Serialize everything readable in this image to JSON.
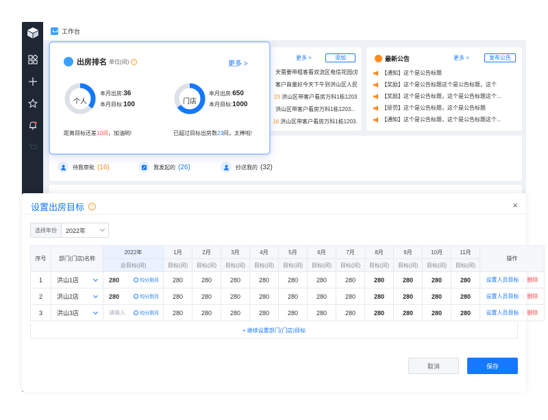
{
  "app": {
    "workbench_title": "工作台"
  },
  "task_list": {
    "more": "更多 >",
    "add": "添加",
    "rows": [
      "天需要带租客看双流区电信花园(双...",
      "客户商量好今天下午到洪山区人民...",
      "洪山区带客户看房万科1栋1203...",
      "洪山区带客户看房万科1栋1203...",
      "洪山区带客户看房万科1栋1203..."
    ],
    "row_prefixes": [
      "",
      "",
      "23",
      "",
      "16"
    ]
  },
  "announcements": {
    "title": "最新公告",
    "more": "更多 >",
    "publish": "发布公告",
    "rows": [
      "【通知】这个是公告标题",
      "【奖励】这个是公告标题这个是公告标题，这个",
      "【奖励】这个是公告标题，这个是公告标题这个...",
      "【惩罚】这个是公告标题，这个是公告标题",
      "【通知】这个是公告标题，这个是公告标题这个..."
    ]
  },
  "quick": [
    {
      "label": "待我审批",
      "count": "(16)"
    },
    {
      "label": "我发起的",
      "count": "(26)"
    },
    {
      "label": "抄送我的",
      "count": "(32)"
    }
  ],
  "ranking": {
    "title": "出房排名",
    "unit": "单位(间)",
    "more": "更多 >",
    "personal": {
      "label": "个人",
      "month_out_label": "本月出房:",
      "month_out": "36",
      "month_target_label": "本月目标:",
      "month_target": "100",
      "progress": 0.36,
      "note_before": "距离目标还差",
      "note_value": "10间",
      "note_after": "，加油哟!"
    },
    "store": {
      "label": "门店",
      "month_out_label": "本月出房:",
      "month_out": "650",
      "month_target_label": "本月目标:",
      "month_target": "1000",
      "progress": 0.65,
      "note_before": "已超过目标出房数",
      "note_value": "23",
      "note_after": "间，太棒啦!"
    }
  },
  "modal": {
    "title": "设置出房目标",
    "close": "×",
    "year_label": "选择年份",
    "year_value": "2022年",
    "columns": {
      "index": "序号",
      "dept": "部门(门店)名称",
      "year": "2022年",
      "year_sub": "总目标(间)",
      "months": [
        "1月",
        "2月",
        "3月",
        "4月",
        "5月",
        "6月",
        "7月",
        "8月",
        "9月",
        "10月",
        "11月"
      ],
      "month_sub": "目标(间)",
      "ops": "操作"
    },
    "rows": [
      {
        "index": "1",
        "name": "洪山1店",
        "total": "280",
        "avg": "均分到月",
        "months": [
          "280",
          "280",
          "280",
          "280",
          "280",
          "280",
          "280",
          "280",
          "280",
          "280",
          "280"
        ],
        "set": "设置人员目标",
        "del": "删除"
      },
      {
        "index": "2",
        "name": "洪山2店",
        "total": "280",
        "avg": "均分到月",
        "months": [
          "280",
          "280",
          "280",
          "280",
          "280",
          "280",
          "280",
          "280",
          "280",
          "280",
          "280"
        ],
        "set": "设置人员目标",
        "del": "删除"
      },
      {
        "index": "3",
        "name": "洪山3店",
        "total_placeholder": "请输入",
        "avg": "均分到月",
        "months": [
          "280",
          "280",
          "280",
          "280",
          "280",
          "280",
          "280",
          "280",
          "280",
          "280",
          "280"
        ],
        "set": "设置人员目标",
        "del": "删除"
      }
    ],
    "add_more": "+ 继续设置部门(门店)目标",
    "cancel": "取消",
    "save": "保存"
  },
  "colors": {
    "accent": "#1677ff",
    "danger": "#ff4d4f",
    "warning": "#ff8a1f",
    "sidebar": "#1e2733"
  }
}
